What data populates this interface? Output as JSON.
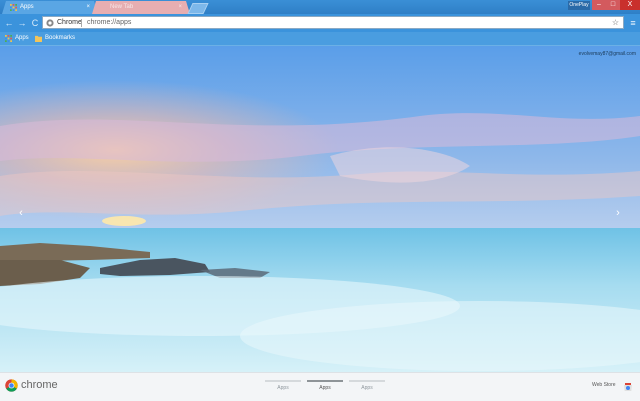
{
  "tabs": [
    {
      "label": "Apps",
      "close": "×",
      "state": "active"
    },
    {
      "label": "New Tab",
      "close": "×",
      "state": "inactive"
    }
  ],
  "window": {
    "profile_label": "OnePlay",
    "minimize": "‒",
    "maximize": "□",
    "close": "X"
  },
  "toolbar": {
    "back": "←",
    "forward": "→",
    "reload": "C",
    "omnibox_chip": "Chrome",
    "url": "chrome://apps",
    "star": "☆",
    "menu": "≡"
  },
  "bookmarks": [
    {
      "label": "Apps",
      "icon": "apps-grid-icon"
    },
    {
      "label": "Bookmarks",
      "icon": "folder-icon"
    }
  ],
  "account": {
    "email": "evolvemay87@gmail.com"
  },
  "carousel": {
    "prev": "‹",
    "next": "›"
  },
  "bottom_bar": {
    "brand": "chrome",
    "pages": [
      {
        "label": "Apps",
        "active": false
      },
      {
        "label": "Apps",
        "active": true
      },
      {
        "label": "Apps",
        "active": false
      }
    ],
    "webstore": "Web Store"
  },
  "colors": {
    "tabstrip": "#3a8fd6",
    "toolbar": "#3b93dc",
    "close_button": "#c9302c",
    "sky_top": "#5b9ee8",
    "sunset_glow": "#f6c7a0",
    "sea": "#a9ddf0"
  }
}
